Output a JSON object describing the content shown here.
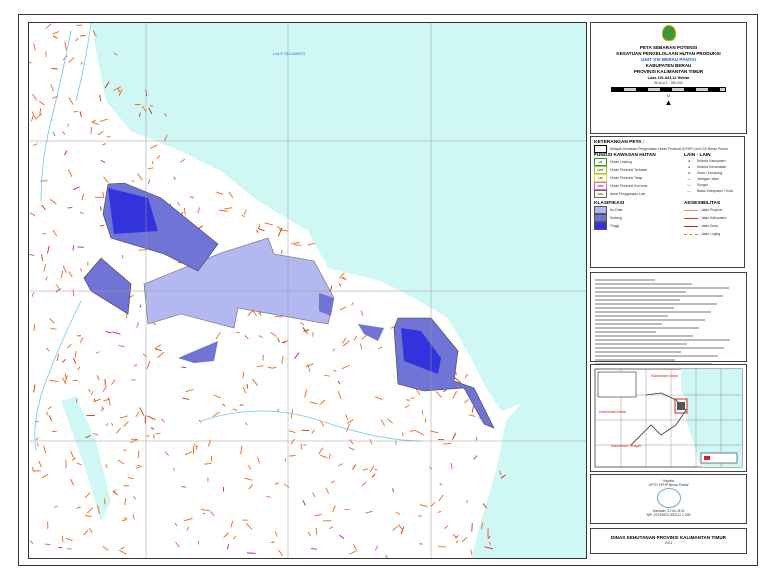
{
  "map": {
    "sea_label": "LAUT SULAWESI"
  },
  "title": {
    "line1": "PETA SEBARAN POTENSI",
    "line2": "KESATUAN PENGELOLAAN HUTAN PRODUKSI",
    "line3": "UNIT XVI BERAU PANTAI",
    "line4": "KABUPATEN BERAU",
    "line5": "PROVINSI KALIMANTAN TIMUR",
    "area": "Luas 191.843,12 Hektar",
    "scale": "SKALA 1 : 250.000",
    "north": "U",
    "colors": {
      "title_accent": "#1f5fd1"
    }
  },
  "legend": {
    "heading": "KETERANGAN PETA :",
    "boundary": "Wilayah Kesatuan Pengelolaan Hutan Produksi (KPHP) Unit XVI Berau Pantai",
    "forest_heading": "FUNGSI KAWASAN HUTAN",
    "forest": [
      {
        "code": "HL",
        "label": "Hutan Lindung",
        "color": "#2a9a2a"
      },
      {
        "code": "HPT",
        "label": "Hutan Produksi Terbatas",
        "color": "#9acd32"
      },
      {
        "code": "HP",
        "label": "Hutan Produksi Tetap",
        "color": "#e8e83a"
      },
      {
        "code": "HPK",
        "label": "Hutan Produksi Konversi",
        "color": "#e060e0"
      },
      {
        "code": "APL",
        "label": "Areal Penggunaan Lain",
        "color": "#666666"
      }
    ],
    "other_heading": "LAIN - LAIN",
    "other": [
      "Ibukota Kabupaten",
      "Ibukota Kecamatan",
      "Desa / Kampung",
      "Jaringan Jalan",
      "Sungai",
      "Batas Kabupaten / Kota"
    ],
    "class_heading": "KLASIFIKASI",
    "classes": [
      {
        "label": "No Data",
        "color": "#b4b8f0"
      },
      {
        "label": "Sedang",
        "color": "#6f74d6"
      },
      {
        "label": "Tinggi",
        "color": "#3333dd"
      }
    ],
    "access_heading": "AKSESIBILITAS",
    "access": [
      {
        "label": "Jalan Propinsi",
        "color": "#f08a50"
      },
      {
        "label": "Jalan Kabupaten",
        "color": "#e03020"
      },
      {
        "label": "Jalan Desa",
        "color": "#c82020"
      },
      {
        "label": "Jalan Loging",
        "color": "#f07020"
      }
    ]
  },
  "inset": {
    "label_west": "Kalimantan Barat",
    "label_center": "Kalimantan Tengah",
    "label_north": "Kalimantan Utara"
  },
  "signature": {
    "role": "Kepala",
    "office": "UPTD KPHP Berau Pantai",
    "name": "Hamzah, S.Hut, M.Si",
    "nip": "NIP. 19730823 200212 1 005"
  },
  "footer": {
    "agency": "DINAS KEHUTANAN PROVINSI KALIMANTAN TIMUR",
    "year": "2021"
  }
}
